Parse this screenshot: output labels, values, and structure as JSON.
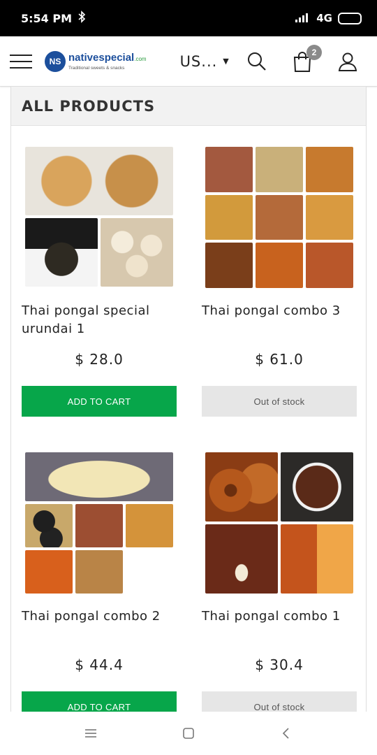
{
  "status": {
    "time": "5:54 PM",
    "network": "4G"
  },
  "header": {
    "logo_mark": "NS",
    "logo_name": "nativespecial",
    "logo_domain": ".com",
    "logo_tagline": "Traditional sweets & snacks",
    "currency": "US...",
    "cart_count": "2"
  },
  "section": {
    "title": "ALL PRODUCTS"
  },
  "products": [
    {
      "name": "Thai pongal special urundai 1",
      "price": "$ 28.0",
      "button": "ADD TO CART",
      "in_stock": true
    },
    {
      "name": "Thai pongal combo 3",
      "price": "$ 61.0",
      "button": "Out of stock",
      "in_stock": false
    },
    {
      "name": "Thai pongal combo 2",
      "price": "$ 44.4",
      "button": "ADD TO CART",
      "in_stock": true
    },
    {
      "name": "Thai pongal combo 1",
      "price": "$ 30.4",
      "button": "Out of stock",
      "in_stock": false
    }
  ],
  "colors": {
    "add_button": "#07a64a",
    "oos_button": "#e6e6e6",
    "brand": "#1c4f9c"
  }
}
